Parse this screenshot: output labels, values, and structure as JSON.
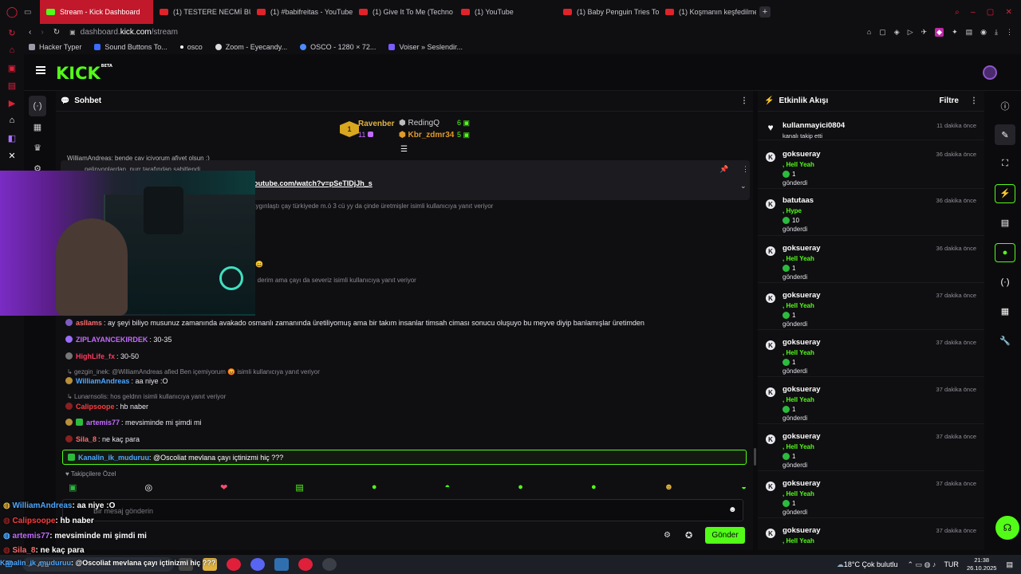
{
  "browser": {
    "tabs": [
      {
        "label": "Stream - Kick Dashboard",
        "active": true
      },
      {
        "label": "(1) TESTERE NECMİ BU A",
        "active": false
      },
      {
        "label": "(1) #babifreitas - YouTube",
        "active": false
      },
      {
        "label": "(1) Give It To Me (Techno",
        "active": false
      },
      {
        "label": "(1) YouTube",
        "active": false
      },
      {
        "label": "(1) Baby Penguin Tries To",
        "active": false
      },
      {
        "label": "(1) Koşmanın keşfedilmed",
        "active": false
      }
    ],
    "url_prefix": "dashboard.",
    "url_domain": "kick.com",
    "url_path": "/stream",
    "bookmarks": [
      "Hacker Typer",
      "Sound Buttons To...",
      "osco",
      "Zoom - Eyecandy...",
      "OSCO - 1280 × 72...",
      "Voiser » Seslendir..."
    ]
  },
  "kick": {
    "logo": "KICK",
    "logo_beta": "BETA"
  },
  "chat": {
    "title": "Sohbet",
    "leaderboard": {
      "first": {
        "name": "Ravenber",
        "count": "11",
        "rank": "1"
      },
      "second": {
        "name": "RedingQ",
        "count": "6"
      },
      "third": {
        "name": "Kbr_zdmr34",
        "count": "5"
      }
    },
    "partial_top": "WilliamAndreas: bende çay içiyorum afiyet olsun :)",
    "pinned": {
      "by": "pelinyoplardan_nurr tarafından sabitlendi",
      "link": "outube.com/watch?v=pSeTIDjJh_s"
    },
    "reply_fragment_1": "aygınlaştı çay türkiyede m.ö 3 cü yy da çinde üretmişler isimli kullanıcıya yanıt veriyor",
    "reply_fragment_2": "e derim ama çayı da severiz isimli kullanıcıya yanıt veriyor",
    "messages": [
      {
        "user": "asllams",
        "text": ": ay şeyi biliyo musunuz zamanında avakado osmanlı zamanında üretiliyomuş ama bir takım insanlar timsah ciması sonucu oluşuyo bu meyve diyip banlamışlar üretimden",
        "color": "#ff6c6c"
      },
      {
        "user": "ZIPLAYANCEKIRDEK",
        "text": ": 30-35",
        "color": "#c46bff"
      },
      {
        "user": "HighLife_fx",
        "text": ": 30-50",
        "color": "#ff3b5c"
      },
      {
        "reply": "gezgin_inek: @WilliamAndreas afied Ben içemiyorum 😡 isimli kullanıcıya yanıt veriyor"
      },
      {
        "user": "WilliamAndreas",
        "text": ": aa niye :O",
        "color": "#4ea7ff"
      },
      {
        "reply": "Lunarnsolis: hos geldnn isimli kullanıcıya yanıt veriyor"
      },
      {
        "user": "Calipsoope",
        "text": ": hb naber",
        "color": "#ff3b3b"
      },
      {
        "user": "artemis77",
        "text": ": mevsiminde mi şimdi mi",
        "color": "#c46bff"
      },
      {
        "user": "Sila_8",
        "text": ": ne kaç para",
        "color": "#ff6c6c"
      }
    ],
    "highlight": {
      "user": "Kanalin_ik_muduruu",
      "text": ": @Oscoliat mevlana çayı içtinizmi hiç ???"
    },
    "followers_label": "Takipçilere Özel",
    "input_placeholder": "Bir mesaj gönderin",
    "send_label": "Gönder"
  },
  "activity": {
    "title": "Etkinlik Akışı",
    "filter_label": "Filtre",
    "items": [
      {
        "name": "kullanmayici0804",
        "time": "11 dakika önce",
        "sub": "",
        "detail": "kanalı takip etti",
        "amount": ""
      },
      {
        "name": "goksueray",
        "time": "36 dakika önce",
        "sub": ", Hell Yeah",
        "amount": "1",
        "detail": "gönderdi"
      },
      {
        "name": "batutaas",
        "time": "36 dakika önce",
        "sub": ", Hype",
        "amount": "10",
        "detail": "gönderdi"
      },
      {
        "name": "goksueray",
        "time": "36 dakika önce",
        "sub": ", Hell Yeah",
        "amount": "1",
        "detail": "gönderdi"
      },
      {
        "name": "goksueray",
        "time": "37 dakika önce",
        "sub": ", Hell Yeah",
        "amount": "1",
        "detail": "gönderdi"
      },
      {
        "name": "goksueray",
        "time": "37 dakika önce",
        "sub": ", Hell Yeah",
        "amount": "1",
        "detail": "gönderdi"
      },
      {
        "name": "goksueray",
        "time": "37 dakika önce",
        "sub": ", Hell Yeah",
        "amount": "1",
        "detail": "gönderdi"
      },
      {
        "name": "goksueray",
        "time": "37 dakika önce",
        "sub": ", Hell Yeah",
        "amount": "1",
        "detail": "gönderdi"
      },
      {
        "name": "goksueray",
        "time": "37 dakika önce",
        "sub": ", Hell Yeah",
        "amount": "1",
        "detail": "gönderdi"
      },
      {
        "name": "goksueray",
        "time": "37 dakika önce",
        "sub": ", Hell Yeah",
        "amount": "",
        "detail": ""
      }
    ]
  },
  "overlay": {
    "lines": [
      {
        "user": "WilliamAndreas",
        "text": ": aa niye :O",
        "color": "#4ea7ff"
      },
      {
        "user": "Calipsoope",
        "text": ": hb naber",
        "color": "#ff3b3b"
      },
      {
        "user": "artemis77",
        "text": ": mevsiminde mi şimdi mi",
        "color": "#c46bff"
      },
      {
        "user": "Sila_8",
        "text": ": ne kaç para",
        "color": "#ff6c6c"
      }
    ],
    "bottom_user": "Kanalin_ik_muduruu",
    "bottom_text": ": @Oscoliat mevlana çayı içtinizmi hiç ???"
  },
  "taskbar": {
    "search_label": "Ara",
    "weather": "18°C  Çok bulutlu",
    "lang": "TUR",
    "time": "21:38",
    "date": "26.10.2025"
  },
  "colors": {
    "kick_green": "#53fc18",
    "opera_red": "#e0203a"
  }
}
